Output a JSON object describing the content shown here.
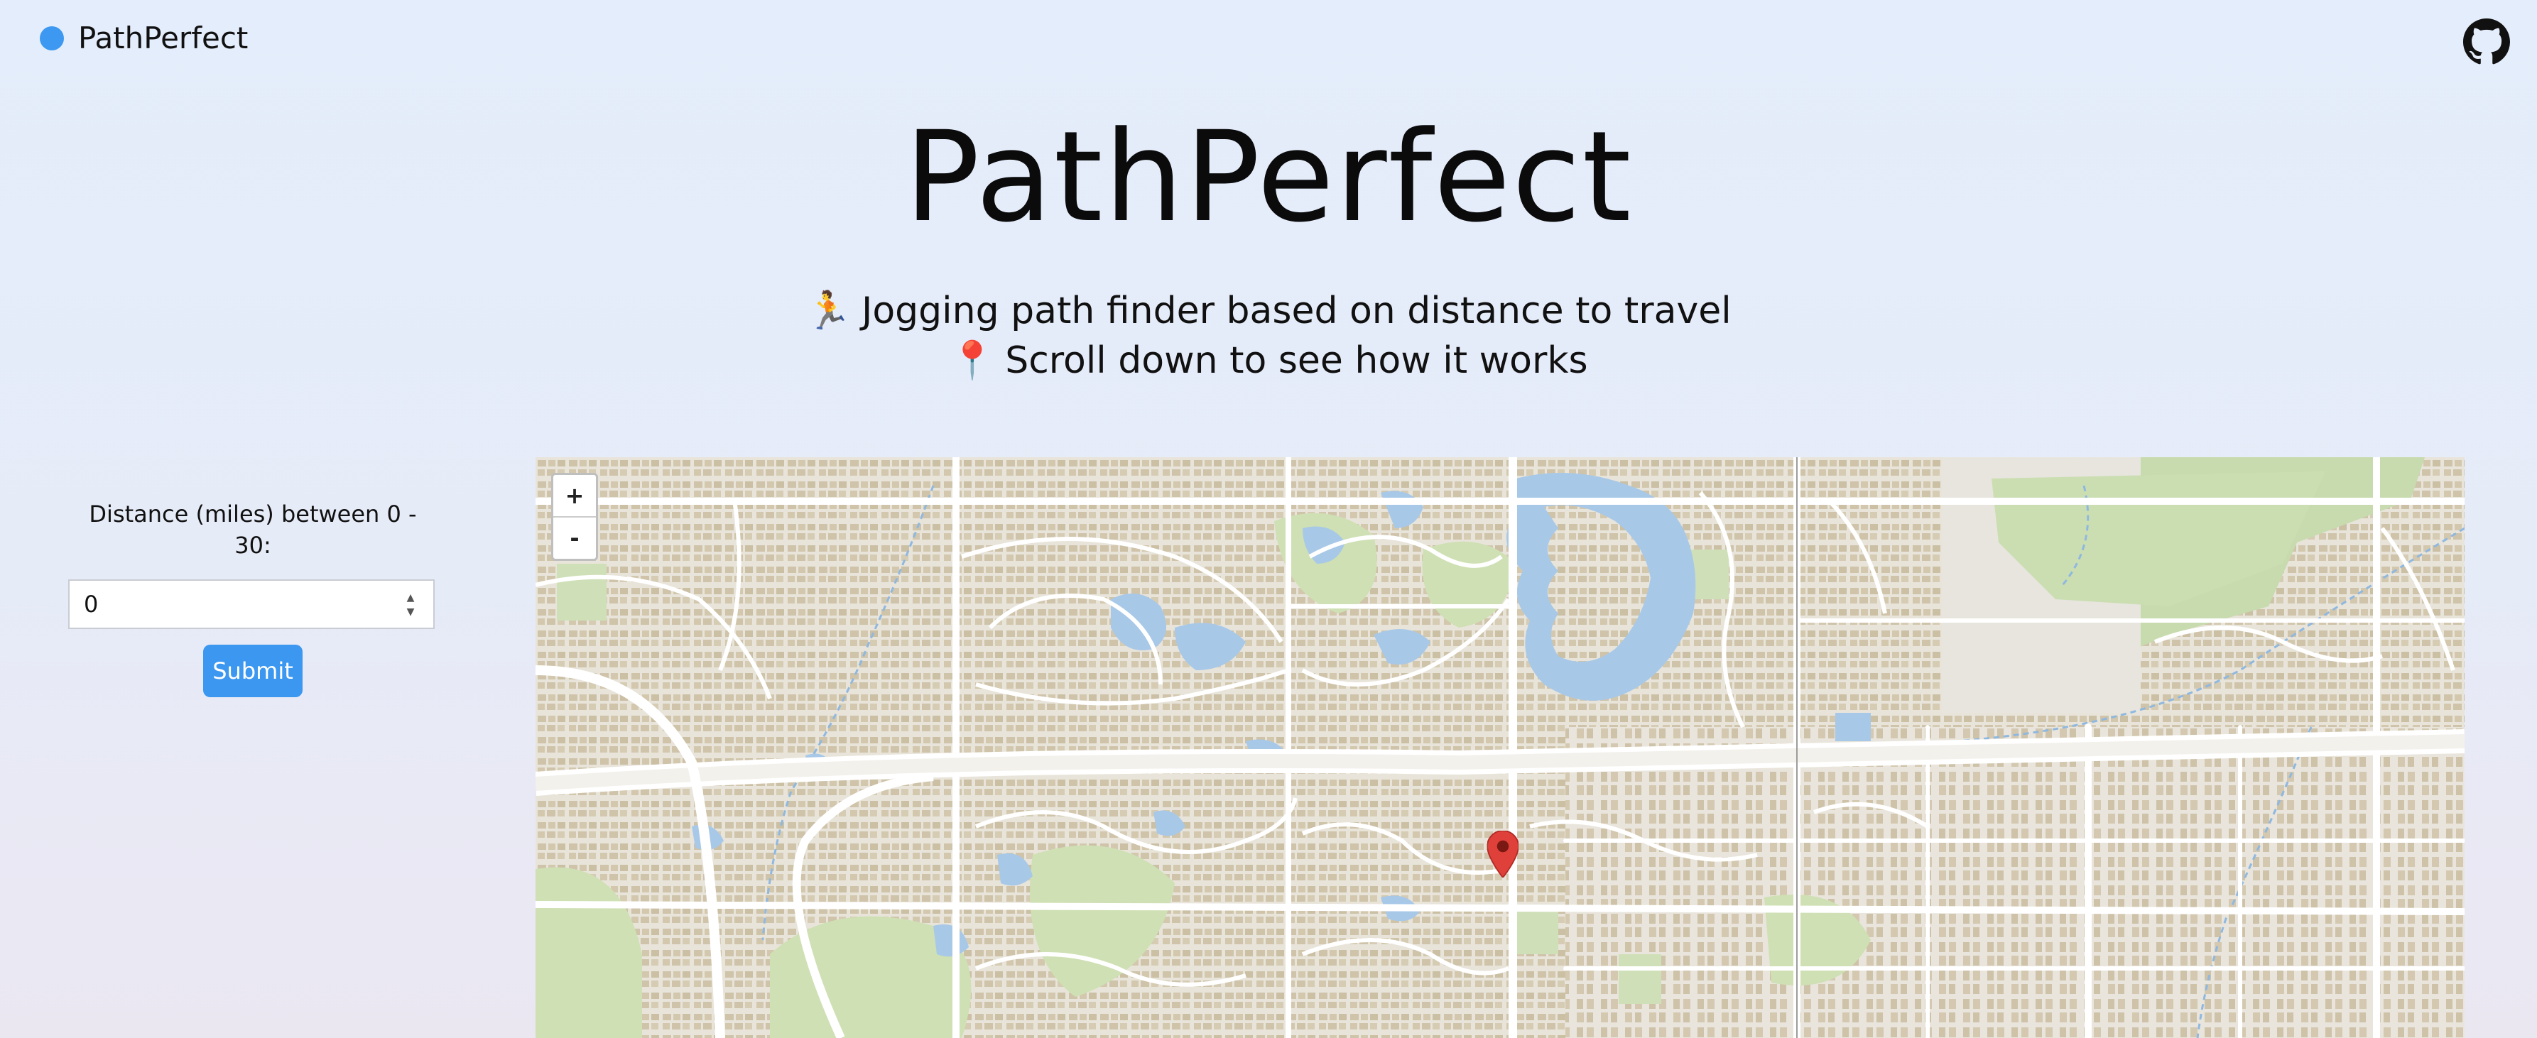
{
  "nav": {
    "brand": "PathPerfect",
    "brand_color": "#3c98f1",
    "github_icon": "github-icon"
  },
  "hero": {
    "title": "PathPerfect",
    "line1_emoji": "🏃",
    "line1": "Jogging path finder based on distance to travel",
    "line2_emoji": "📍",
    "line2": "Scroll down to see how it works"
  },
  "form": {
    "label": "Distance (miles) between 0 - 30:",
    "distance_value": "0",
    "submit_label": "Submit",
    "button_color": "#3b97f0"
  },
  "map": {
    "zoom_in_label": "+",
    "zoom_out_label": "-",
    "marker_icon": "map-pin-icon",
    "marker_color": "#e0403a",
    "water_color": "#a8c8e8",
    "park_color": "#c9dcb0",
    "road_color": "#ffffff"
  }
}
